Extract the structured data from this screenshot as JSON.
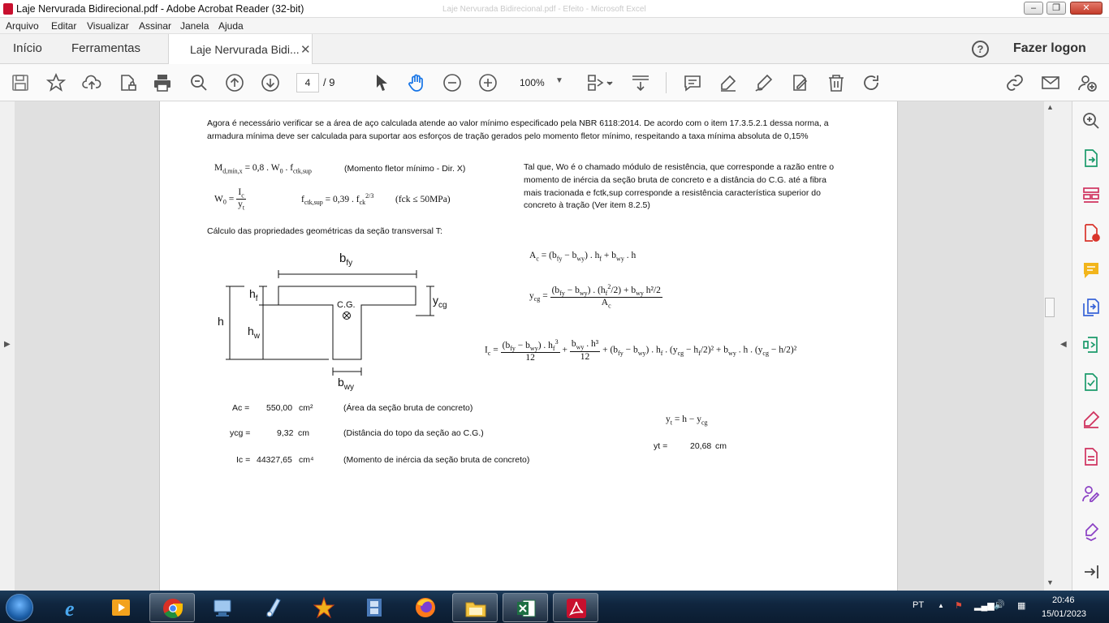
{
  "window": {
    "title": "Laje Nervurada Bidirecional.pdf - Adobe Acrobat Reader (32-bit)",
    "ghost_title": "Laje Nervurada Bidirecional.pdf - Efeito - Microsoft Excel"
  },
  "menu": [
    "Arquivo",
    "Editar",
    "Visualizar",
    "Assinar",
    "Janela",
    "Ajuda"
  ],
  "tabs": {
    "home": "Início",
    "tools": "Ferramentas",
    "doc": "Laje Nervurada Bidi...",
    "close": "✕"
  },
  "account": {
    "help": "?",
    "login": "Fazer logon"
  },
  "toolbar": {
    "page_current": "4",
    "page_total": "/ 9",
    "zoom": "100%"
  },
  "document": {
    "intro1": "Agora é necessário verificar se a área de aço calculada atende ao valor mínimo especificado pela NBR 6118:2014. De acordo com o item 17.3.5.2.1 dessa norma, a",
    "intro2": "armadura mínima deve ser calculada para suportar aos esforços de tração gerados pelo momento fletor mínimo, respeitando a taxa mínima absoluta de 0,15%",
    "md_note": "(Momento fletor mínimo - Dir. X)",
    "fck_cond": "(fck ≤ 50MPa)",
    "tal1": "Tal que, Wo é o chamado módulo de resistência, que corresponde  a razão entre o",
    "tal2": "momento de inércia da seção bruta de concreto e a distância do C.G. até a fibra",
    "tal3": "mais tracionada e fctk,sup corresponde a resistência característica superior do",
    "tal4": "concreto à tração (Ver item 8.2.5)",
    "calc_title": "Cálculo das propriedades geométricas da seção transversal T:",
    "fig": {
      "bfy": "b",
      "bfy_sub": "fy",
      "hf": "h",
      "hf_sub": "f",
      "ycg": "y",
      "ycg_sub": "cg",
      "h": "h",
      "hw": "h",
      "hw_sub": "w",
      "cg": "C.G.",
      "bwy": "b",
      "bwy_sub": "wy"
    },
    "results": [
      {
        "label": "Ac =",
        "value": "550,00",
        "unit": "cm²",
        "desc": "(Área da seção bruta de concreto)"
      },
      {
        "label": "ycg =",
        "value": "9,32",
        "unit": "cm",
        "desc": "(Distância do topo da seção ao C.G.)"
      },
      {
        "label": "Ic =",
        "value": "44327,65",
        "unit": "cm⁴",
        "desc": "(Momento de inércia da seção bruta de concreto)"
      }
    ],
    "yt": {
      "label": "yt =",
      "value": "20,68",
      "unit": "cm"
    }
  },
  "tray": {
    "lang": "PT",
    "time": "20:46",
    "date": "15/01/2023"
  },
  "icons": [
    "save-icon",
    "star-icon",
    "upload-icon",
    "page-lock-icon",
    "print-icon",
    "zoom-search-icon",
    "page-up-icon",
    "page-down-icon",
    "cursor-icon",
    "hand-icon",
    "zoom-out-icon",
    "zoom-in-icon",
    "fit-page-icon",
    "scroll-mode-icon",
    "comment-icon",
    "highlight-icon",
    "sign-icon",
    "edit-pdf-icon",
    "delete-icon",
    "rotate-icon",
    "link-icon",
    "mail-icon",
    "share-user-icon"
  ]
}
